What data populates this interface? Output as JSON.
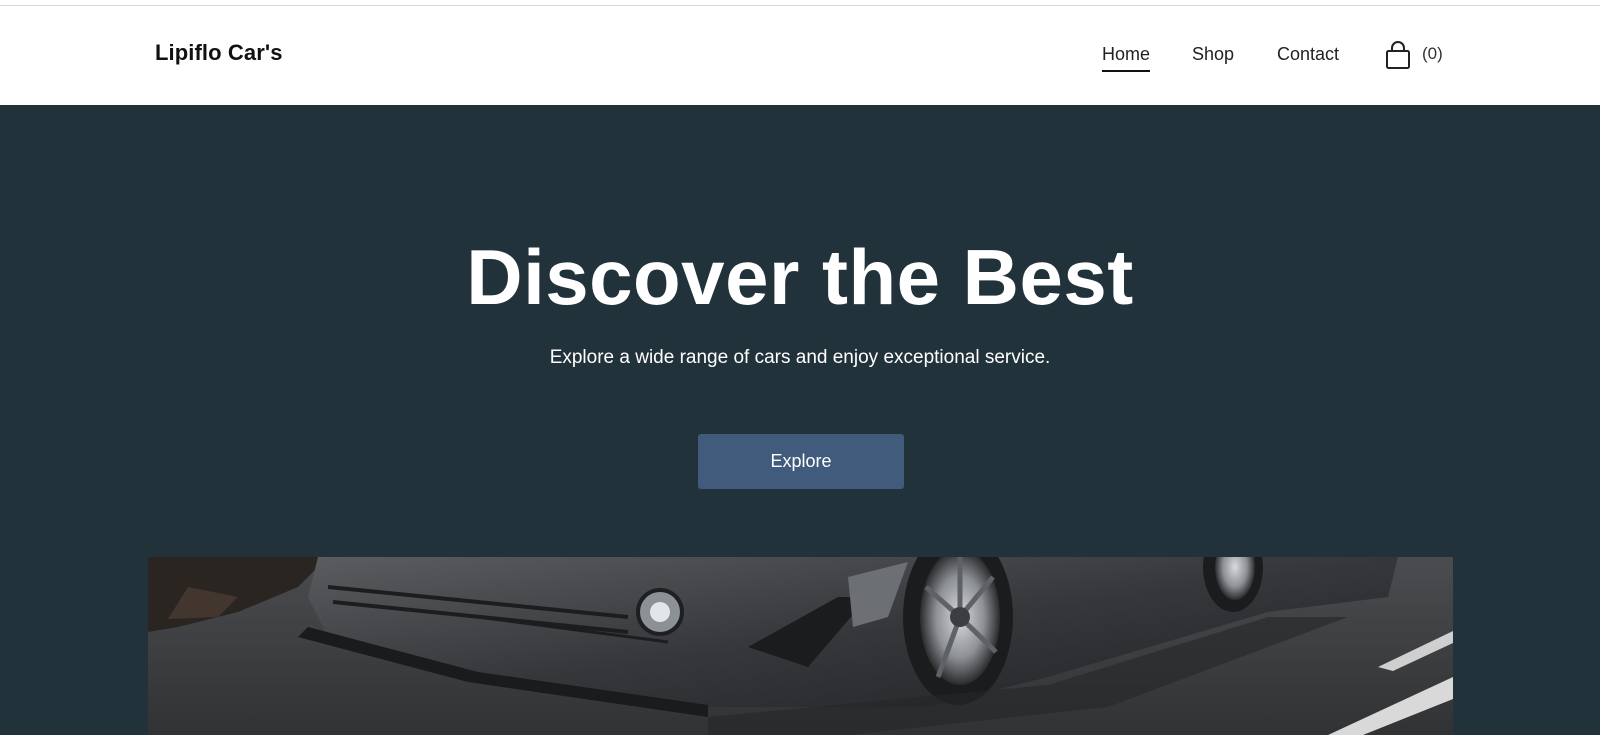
{
  "brand": {
    "name": "Lipiflo Car's"
  },
  "nav": {
    "items": [
      {
        "label": "Home",
        "active": true
      },
      {
        "label": "Shop",
        "active": false
      },
      {
        "label": "Contact",
        "active": false
      }
    ]
  },
  "cart": {
    "icon": "shopping-bag-icon",
    "count_label": "(0)"
  },
  "hero": {
    "title": "Discover the Best",
    "subtitle": "Explore a wide range of cars and enjoy exceptional service.",
    "button_label": "Explore",
    "image_subject": "sports car photo"
  },
  "colors": {
    "hero_background": "#22323b",
    "button": "#415b7c",
    "header_background": "#ffffff"
  }
}
